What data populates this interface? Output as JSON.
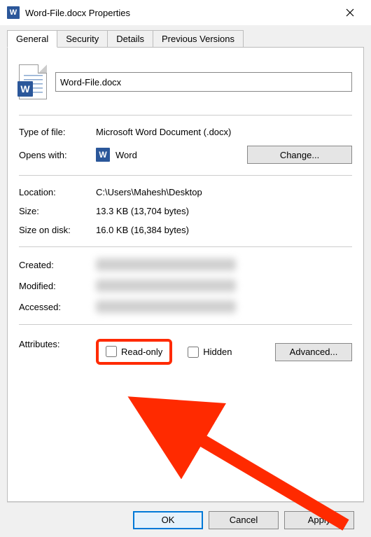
{
  "titlebar": {
    "title": "Word-File.docx Properties",
    "app_icon_letter": "W"
  },
  "tabs": [
    {
      "label": "General",
      "active": true
    },
    {
      "label": "Security",
      "active": false
    },
    {
      "label": "Details",
      "active": false
    },
    {
      "label": "Previous Versions",
      "active": false
    }
  ],
  "general": {
    "filename": "Word-File.docx",
    "type_of_file_label": "Type of file:",
    "type_of_file": "Microsoft Word Document (.docx)",
    "opens_with_label": "Opens with:",
    "opens_with_app": "Word",
    "change_button": "Change...",
    "location_label": "Location:",
    "location": "C:\\Users\\Mahesh\\Desktop",
    "size_label": "Size:",
    "size": "13.3 KB (13,704 bytes)",
    "size_on_disk_label": "Size on disk:",
    "size_on_disk": "16.0 KB (16,384 bytes)",
    "created_label": "Created:",
    "modified_label": "Modified:",
    "accessed_label": "Accessed:",
    "attributes_label": "Attributes:",
    "readonly_label": "Read-only",
    "hidden_label": "Hidden",
    "advanced_button": "Advanced..."
  },
  "footer": {
    "ok": "OK",
    "cancel": "Cancel",
    "apply": "Apply"
  },
  "annotation": {
    "highlight_target": "read-only-checkbox",
    "arrow_color": "#ff2a00"
  }
}
